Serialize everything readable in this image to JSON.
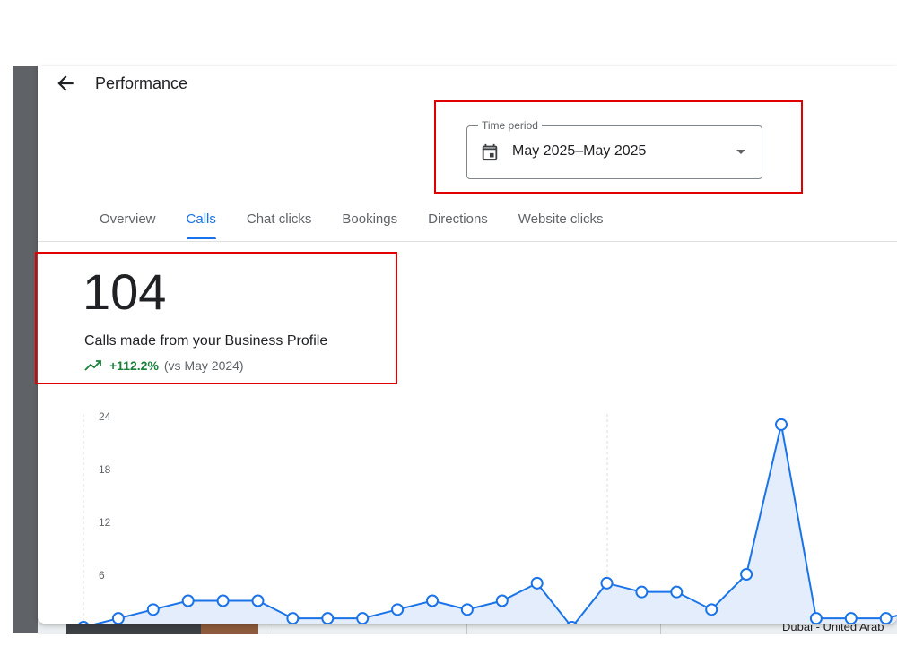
{
  "header": {
    "title": "Performance"
  },
  "time_period": {
    "label": "Time period",
    "value": "May 2025–May 2025"
  },
  "tabs": [
    {
      "label": "Overview",
      "active": false
    },
    {
      "label": "Calls",
      "active": true
    },
    {
      "label": "Chat clicks",
      "active": false
    },
    {
      "label": "Bookings",
      "active": false
    },
    {
      "label": "Directions",
      "active": false
    },
    {
      "label": "Website clicks",
      "active": false
    }
  ],
  "metric": {
    "value": "104",
    "caption": "Calls made from your Business Profile",
    "change": "+112.2%",
    "comparison": "(vs May 2024)"
  },
  "background": {
    "location_text": "Dubai - United Arab"
  },
  "colors": {
    "accent": "#1a73e8",
    "positive": "#188038",
    "highlight": "#e00000",
    "area_fill": "#e3edfc"
  },
  "chart_data": {
    "type": "area",
    "ylim": [
      0,
      24
    ],
    "yticks": [
      "24",
      "18",
      "12",
      "6"
    ],
    "values": [
      0,
      1,
      2,
      3,
      3,
      3,
      1,
      1,
      1,
      2,
      3,
      2,
      3,
      5,
      0,
      5,
      4,
      4,
      2,
      6,
      23,
      1,
      1,
      1,
      2
    ],
    "grid": false
  }
}
